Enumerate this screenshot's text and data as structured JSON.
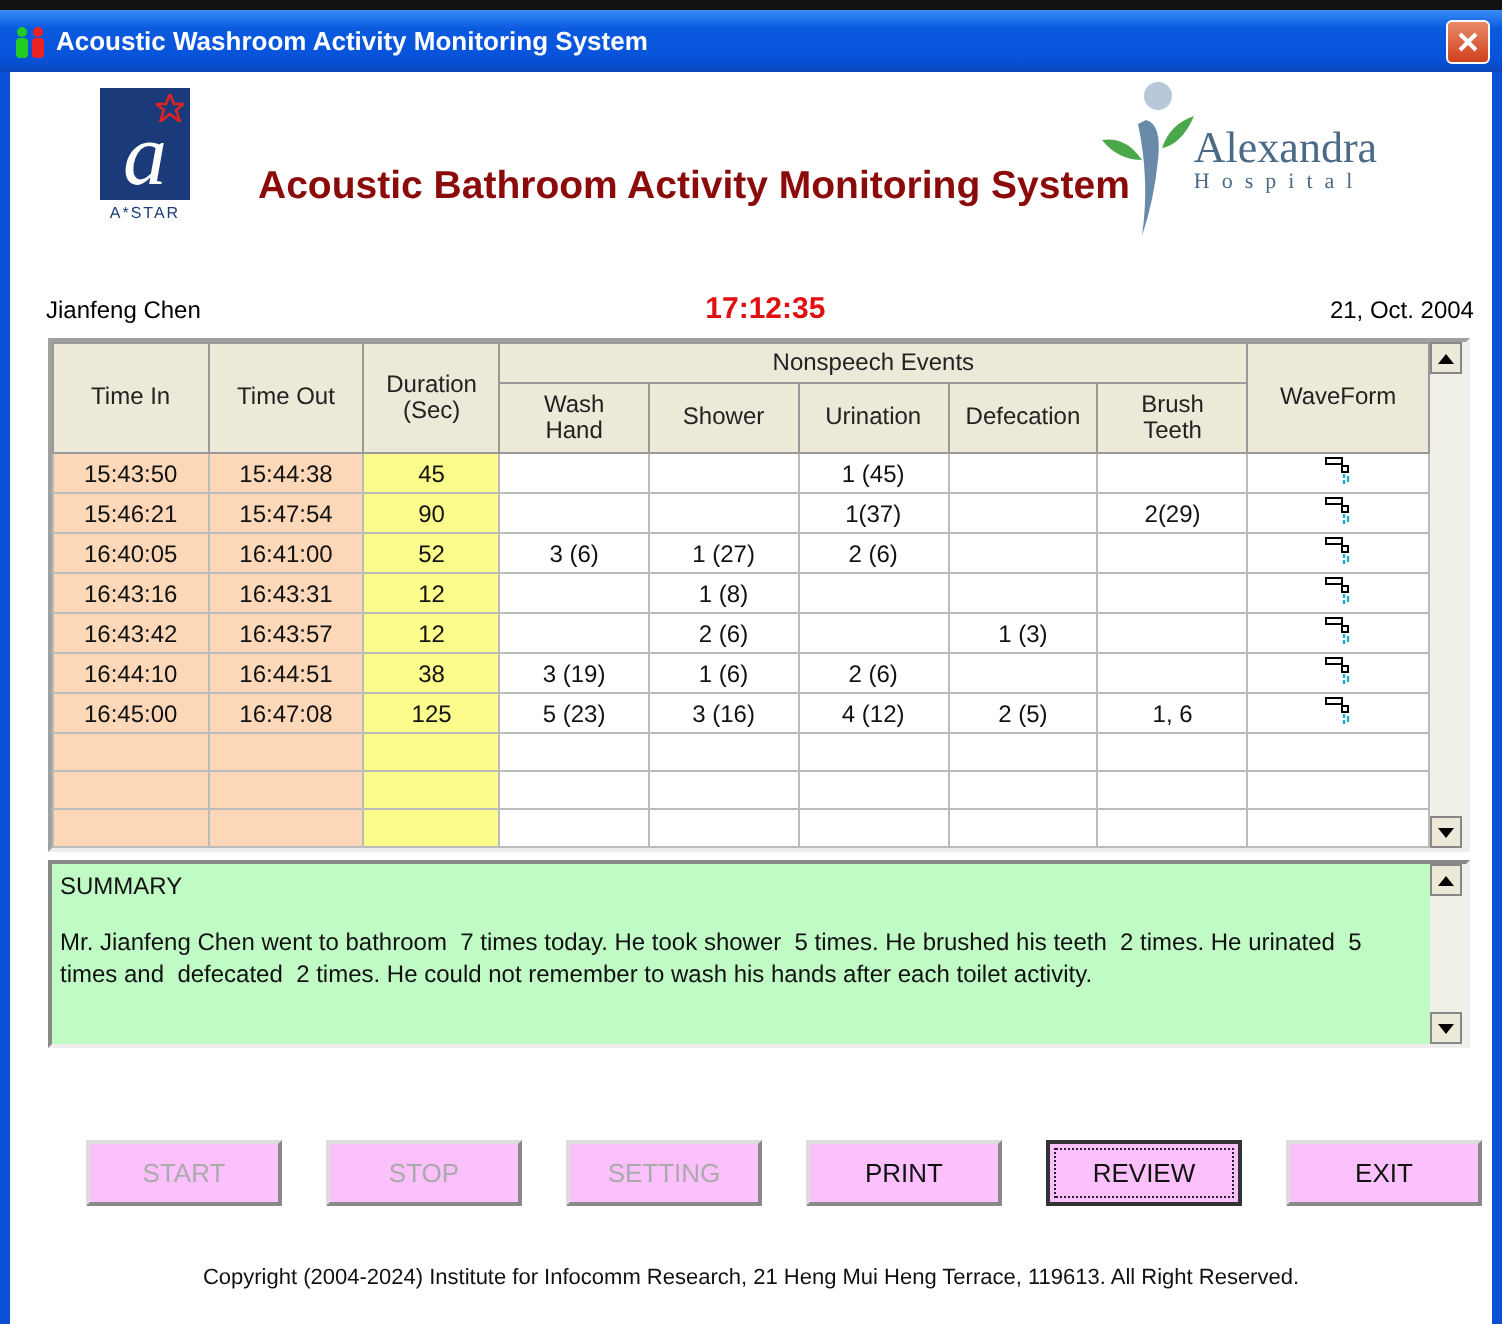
{
  "window": {
    "title": "Acoustic Washroom Activity Monitoring System"
  },
  "header": {
    "left_logo": {
      "mark": "a",
      "caption": "A*STAR"
    },
    "title": "Acoustic Bathroom Activity Monitoring System",
    "right_logo": {
      "name": "Alexandra",
      "sub": "Hospital"
    }
  },
  "info": {
    "user": "Jianfeng Chen",
    "time": "17:12:35",
    "date": "21, Oct. 2004"
  },
  "table": {
    "columns": {
      "time_in": "Time In",
      "time_out": "Time Out",
      "duration": "Duration (Sec)",
      "group": "Nonspeech Events",
      "events": {
        "wash": "Wash Hand",
        "shower": "Shower",
        "urination": "Urination",
        "defecation": "Defecation",
        "teeth": "Brush Teeth"
      },
      "waveform": "WaveForm"
    },
    "rows": [
      {
        "time_in": "15:43:50",
        "time_out": "15:44:38",
        "duration": "45",
        "events": {
          "urination": "1 (45)"
        }
      },
      {
        "time_in": "15:46:21",
        "time_out": "15:47:54",
        "duration": "90",
        "events": {
          "urination": "1(37)",
          "teeth": "2(29)"
        }
      },
      {
        "time_in": "16:40:05",
        "time_out": "16:41:00",
        "duration": "52",
        "events": {
          "wash": "3 (6)",
          "shower": "1 (27)",
          "urination": "2 (6)"
        }
      },
      {
        "time_in": "16:43:16",
        "time_out": "16:43:31",
        "duration": "12",
        "events": {
          "shower": "1 (8)"
        }
      },
      {
        "time_in": "16:43:42",
        "time_out": "16:43:57",
        "duration": "12",
        "events": {
          "shower": "2 (6)",
          "defecation": "1 (3)"
        }
      },
      {
        "time_in": "16:44:10",
        "time_out": "16:44:51",
        "duration": "38",
        "events": {
          "wash": "3 (19)",
          "shower": "1 (6)",
          "urination": "2 (6)"
        }
      },
      {
        "time_in": "16:45:00",
        "time_out": "16:47:08",
        "duration": "125",
        "events": {
          "wash": "5 (23)",
          "shower": "3 (16)",
          "urination": "4 (12)",
          "defecation": "2 (5)",
          "teeth": "1, 6"
        }
      }
    ]
  },
  "summary": {
    "heading": "SUMMARY",
    "text": "Mr. Jianfeng Chen went to bathroom  7 times today. He took shower  5 times. He brushed his teeth  2 times. He urinated  5 times and  defecated  2 times. He could not remember to wash his hands after each toilet activity."
  },
  "buttons": [
    {
      "label": "START",
      "disabled": true,
      "focused": false
    },
    {
      "label": "STOP",
      "disabled": true,
      "focused": false
    },
    {
      "label": "SETTING",
      "disabled": true,
      "focused": false
    },
    {
      "label": "PRINT",
      "disabled": false,
      "focused": false
    },
    {
      "label": "REVIEW",
      "disabled": false,
      "focused": true
    },
    {
      "label": "EXIT",
      "disabled": false,
      "focused": false
    }
  ],
  "footer": "Copyright (2004-2024) Institute for Infocomm Research, 21 Heng Mui Heng Terrace, 119613. All Right Reserved."
}
